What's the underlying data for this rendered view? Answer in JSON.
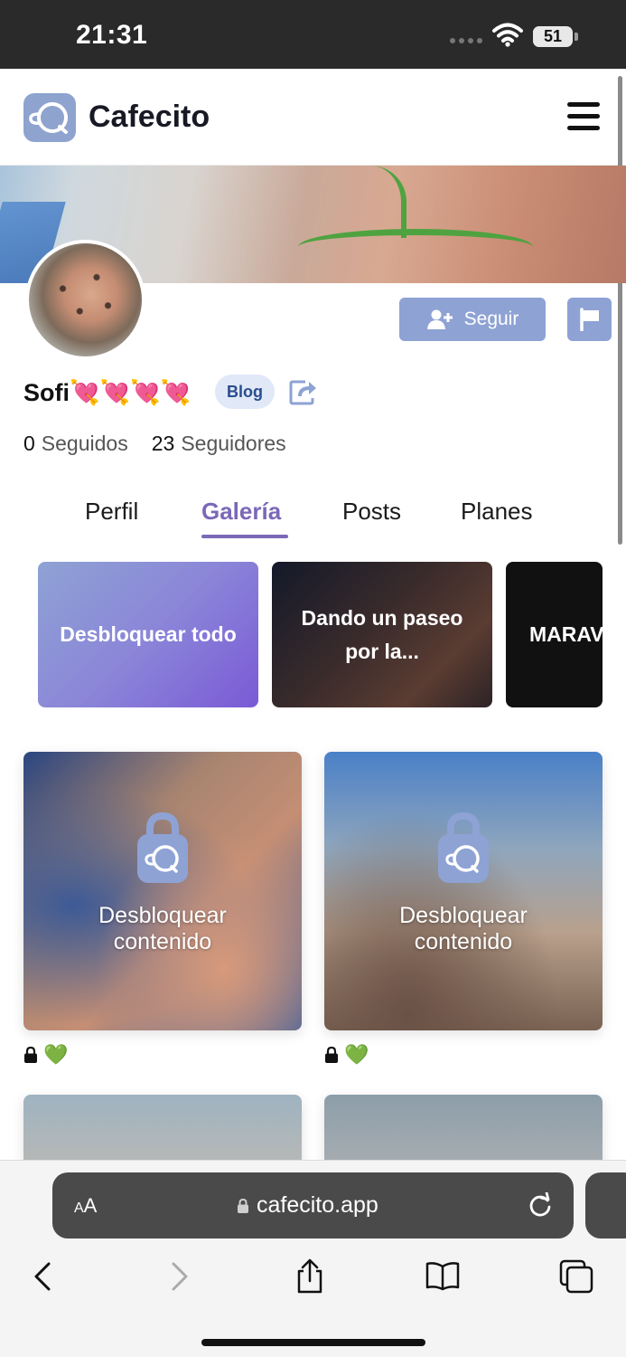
{
  "status_bar": {
    "time": "21:31",
    "battery": "51",
    "battery_level": 0.51
  },
  "header": {
    "brand": "Cafecito",
    "logo_icon": "cafecito-cup-icon",
    "menu_icon": "hamburger-menu-icon"
  },
  "profile": {
    "name": "Sofi💘💘💘💘",
    "badge": "Blog",
    "follow_label": "Seguir",
    "stats": [
      {
        "value": "0",
        "label": "Seguidos"
      },
      {
        "value": "23",
        "label": "Seguidores"
      }
    ]
  },
  "tabs": [
    {
      "label": "Perfil"
    },
    {
      "label": "Galería"
    },
    {
      "label": "Posts"
    },
    {
      "label": "Planes"
    }
  ],
  "active_tab": "Galería",
  "albums": [
    {
      "title": "Desbloquear todo"
    },
    {
      "title": "Dando un paseo por la..."
    },
    {
      "title": "MARAV"
    }
  ],
  "media": {
    "unlock_text_line1": "Desbloquear",
    "unlock_text_line2": "contenido",
    "items": [
      {
        "locked": true,
        "reaction": "💚"
      },
      {
        "locked": true,
        "reaction": "💚"
      }
    ]
  },
  "browser": {
    "text_size_small": "A",
    "text_size_large": "A",
    "url": "cafecito.app"
  },
  "colors": {
    "accent": "#7b68b7",
    "button": "#8ea2d4",
    "status_bar": "#2a2a2a",
    "url_pill": "#4a4a4a"
  }
}
